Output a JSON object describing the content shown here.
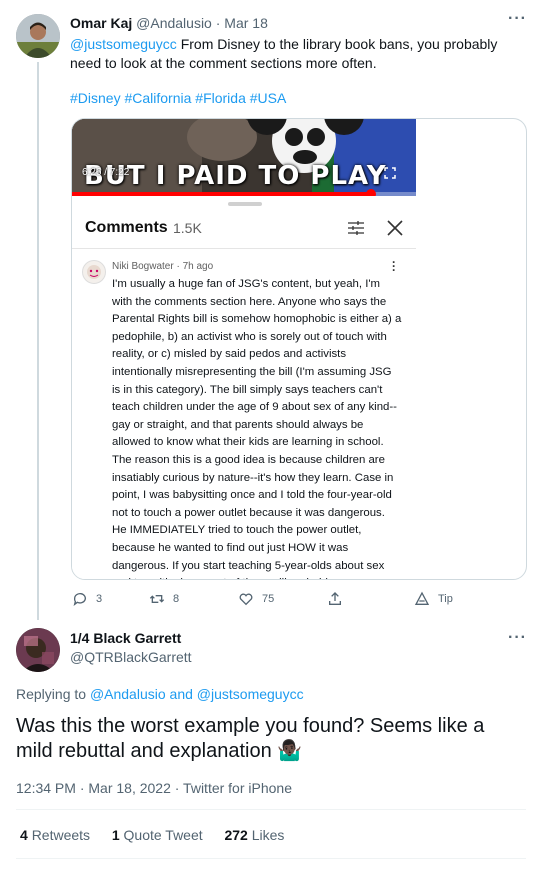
{
  "tweet1": {
    "display_name": "Omar Kaj",
    "handle": "@Andalusio",
    "separator": "·",
    "date": "Mar 18",
    "mention": "@justsomeguycc",
    "text": " From Disney to the library book bans, you probably need to look at the comment sections more often.",
    "hashtags": "#Disney #California #Florida #USA",
    "actions": {
      "replies": "3",
      "retweets": "8",
      "likes": "75",
      "tip": "Tip"
    }
  },
  "video": {
    "caption": "BUT I PAID TO PLAY",
    "time": "6:26 / 7:22",
    "progress": 0.87
  },
  "comments_panel": {
    "title": "Comments",
    "count": "1.5K"
  },
  "comment": {
    "author": "Niki Bogwater",
    "time": "· 7h ago",
    "text": "I'm usually a huge fan of JSG's content, but yeah, I'm with the comments section here. Anyone who says the Parental Rights bill is somehow homophobic is either a) a pedophile, b) an activist who is sorely out of touch with reality, or c) misled by said pedos and activists intentionally misrepresenting the bill (I'm assuming JSG is in this category). The bill simply says teachers can't teach children under the age of 9 about sex of any kind--gay or straight, and that parents should always be allowed to know what their kids are learning in school. The reason this is a good idea is because children are insatiably curious by nature--it's how they learn. Case in point, I was babysitting once and I told the four-year-old not to touch a power outlet because it was dangerous. He IMMEDIATELY tried to touch the power outlet, because he wanted to find out just HOW it was dangerous. If you start teaching 5-year-olds about sex and transitioning, most of them will probably come"
  },
  "tweet2": {
    "display_name": "1/4 Black Garrett",
    "handle": "@QTRBlackGarrett",
    "replying_prefix": "Replying to ",
    "replying_user1": "@Andalusio",
    "replying_and": " and ",
    "replying_user2": "@justsomeguycc",
    "text": "Was this the worst example you found? Seems like a mild rebuttal and explanation",
    "emoji": "🤷🏿‍♂️",
    "timestamp": "12:34 PM · Mar 18, 2022 · Twitter for iPhone",
    "stats": {
      "retweets_count": "4",
      "retweets_label": "Retweets",
      "quotes_count": "1",
      "quotes_label": "Quote Tweet",
      "likes_count": "272",
      "likes_label": "Likes"
    }
  },
  "colors": {
    "link": "#1d9bf0",
    "muted": "#536471",
    "border": "#cfd9de",
    "video_progress": "#ff0000"
  }
}
